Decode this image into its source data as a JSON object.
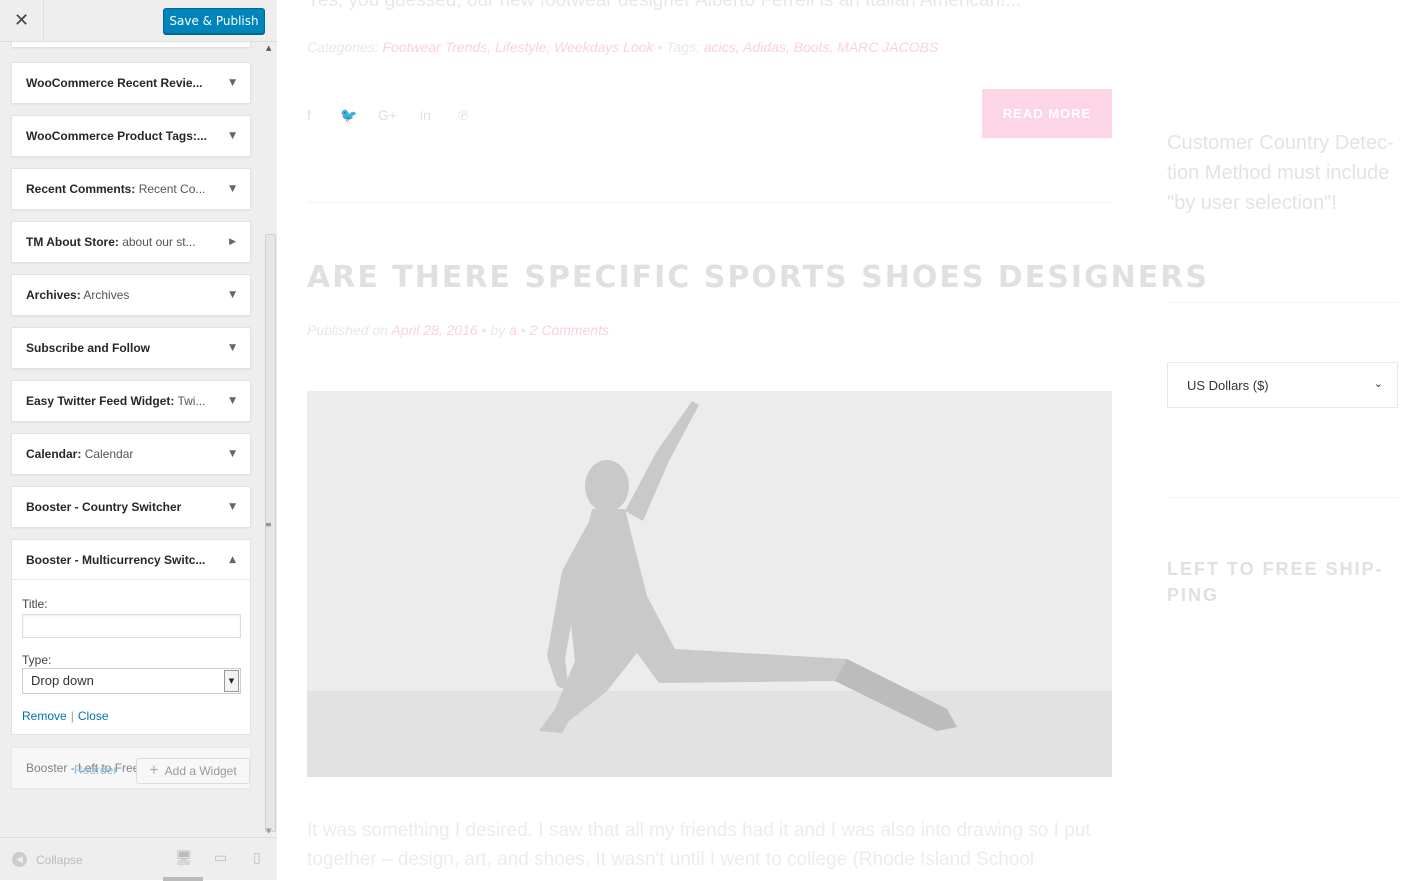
{
  "header": {
    "close_glyph": "✕",
    "publish_label": "Save & Publish"
  },
  "widgets": [
    {
      "title": "WooCommerce Recent Revie...",
      "sub": "",
      "arrow": "▼"
    },
    {
      "title": "WooCommerce Product Tags:...",
      "sub": "",
      "arrow": "▼"
    },
    {
      "title": "Recent Comments:",
      "sub": " Recent Co...",
      "arrow": "▼"
    },
    {
      "title": "TM About Store:",
      "sub": " about our st...",
      "arrow": "▶"
    },
    {
      "title": "Archives:",
      "sub": " Archives",
      "arrow": "▼"
    },
    {
      "title": "Subscribe and Follow",
      "sub": "",
      "arrow": "▼"
    },
    {
      "title": "Easy Twitter Feed Widget:",
      "sub": " Twi...",
      "arrow": "▼"
    },
    {
      "title": "Calendar:",
      "sub": " Calendar",
      "arrow": "▼"
    },
    {
      "title": "Booster - Country Switcher",
      "sub": "",
      "arrow": "▼"
    }
  ],
  "expanded_widget": {
    "title": "Booster - Multicurrency Switc...",
    "arrow": "▲",
    "title_label": "Title:",
    "title_value": "",
    "type_label": "Type:",
    "type_value": "Drop down",
    "type_dd_glyph": "▼",
    "remove_label": "Remove",
    "separator": "|",
    "close_label": "Close"
  },
  "faded_widget": {
    "title": "Booster - Left to Free Shippin...",
    "arrow": "▼"
  },
  "footer_actions": {
    "reorder_label": "Reorder",
    "add_plus": "+",
    "add_label": "Add a Widget"
  },
  "scrollbar": {
    "up": "▲",
    "down": "▼",
    "grip": "≡"
  },
  "footer": {
    "collapse_label": "Collapse",
    "collapse_glyph": "◀",
    "desktop_glyph": "🖥",
    "tablet_glyph": "▭",
    "mobile_glyph": "▯"
  },
  "preview": {
    "excerpt_top": "Yes, you guessed, our new footwear designer Alberto Ferreli is an Italian American!...",
    "categories_label": "Categories:",
    "categories": "Footwear Trends, Lifestyle, Weekdays Look",
    "bullet": "•",
    "tags_label": "Tags:",
    "tags": "acics, Adidas, Boots, MARC JACOBS",
    "social": {
      "facebook": "f",
      "twitter": "🐦",
      "google": "G+",
      "linkedin": "in",
      "pinterest": "℗"
    },
    "read_more": "READ MORE",
    "post_title": "ARE THERE SPECIFIC SPORTS SHOES DESIGNERS",
    "published_on": "Published on",
    "published_date": "April 28, 2016",
    "by_label": "by",
    "author": "a",
    "comments": "2 Comments",
    "body_text": "It was something I desired. I saw that all my friends had it and I was also into drawing so I put together – design, art, and shoes. It wasn't until I went to college (Rhode Island School",
    "side_note": "Customer Country Detec-tion Method must include \"by user selection\"!",
    "currency_value": "US Dollars ($)",
    "currency_chevron": "⌄",
    "side_heading": "LEFT TO FREE SHIP-PING"
  }
}
